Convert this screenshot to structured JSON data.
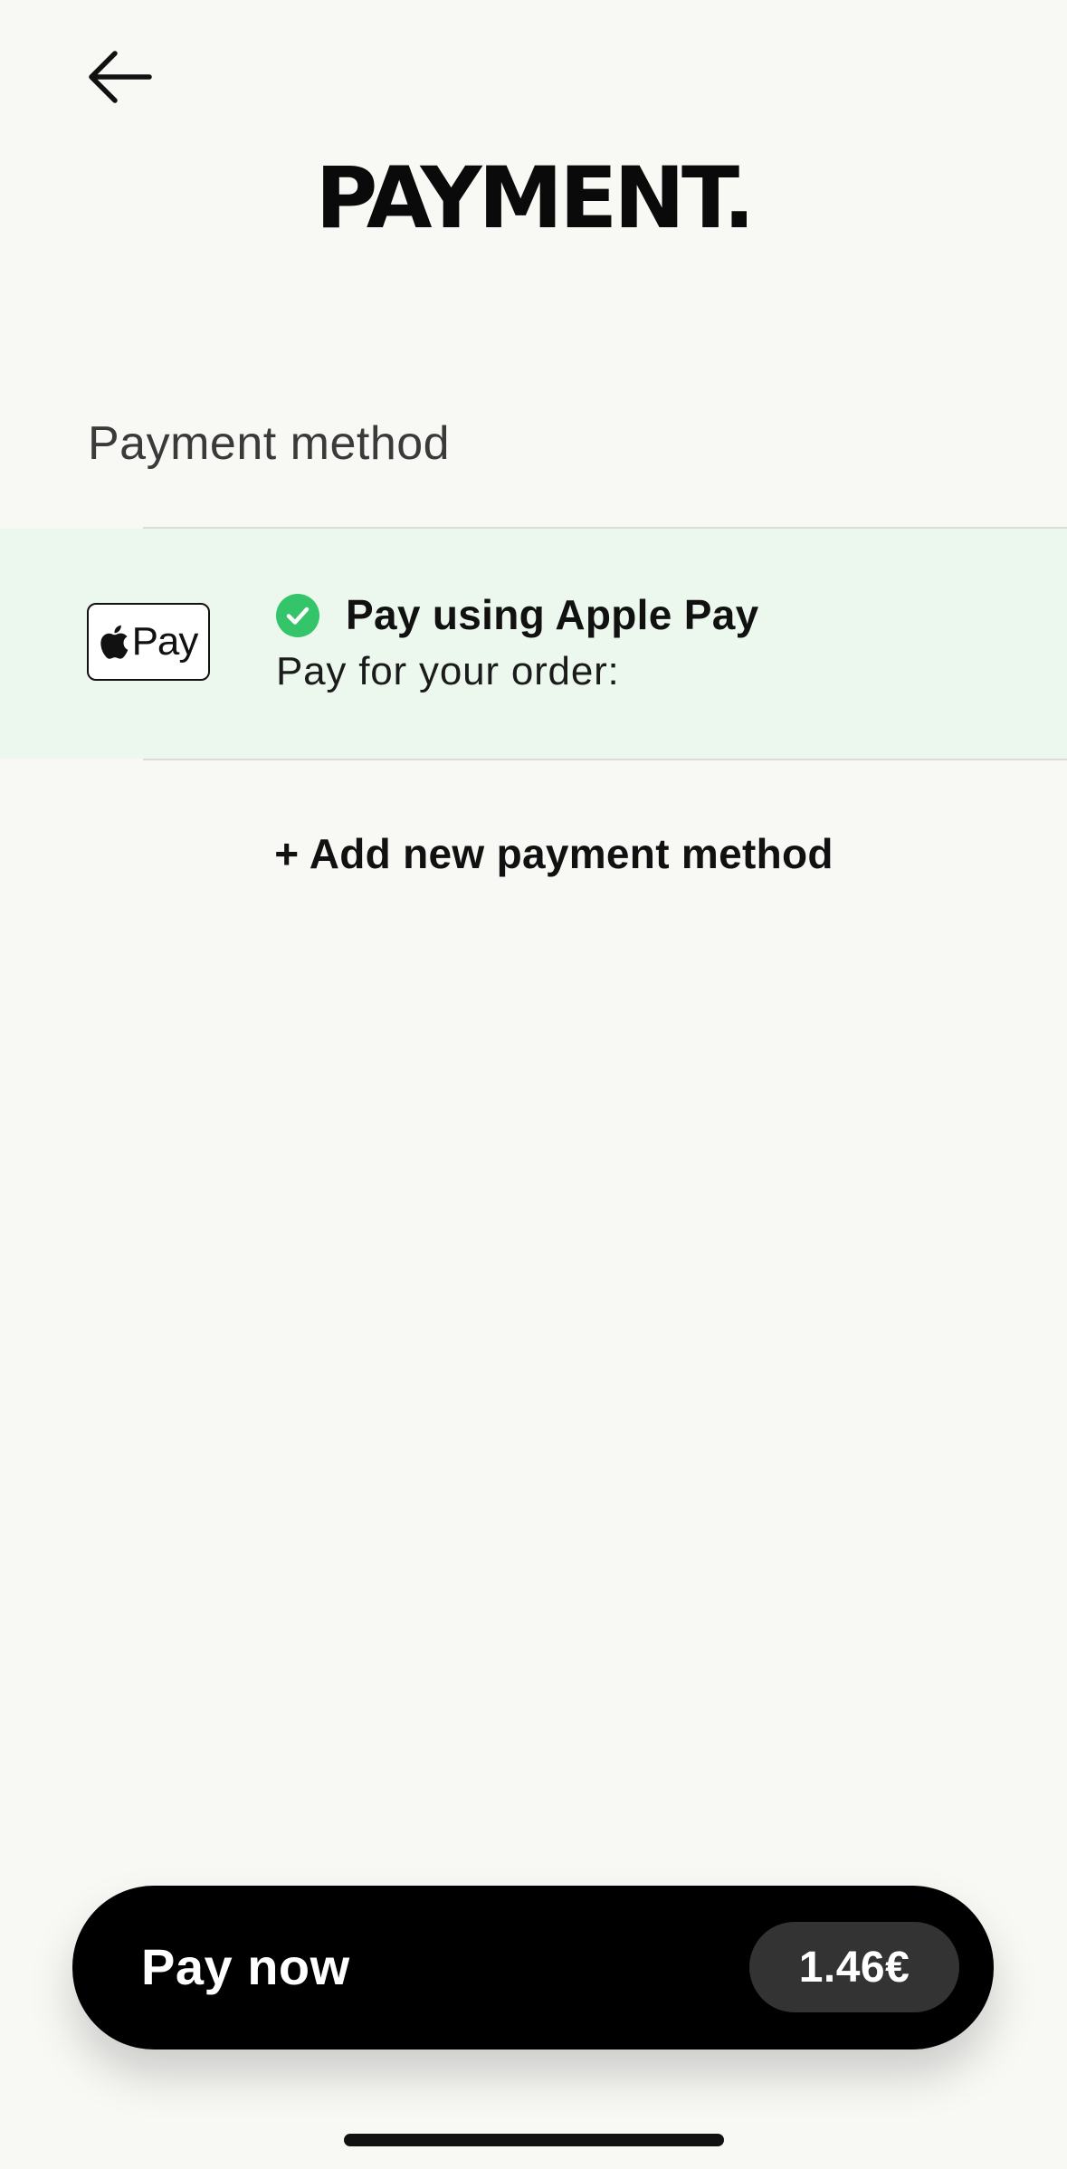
{
  "header": {
    "back_icon": "arrow-left-icon",
    "title": "PAYMENT."
  },
  "payment_section": {
    "label": "Payment method",
    "selected_method": {
      "logo_icon": "apple-pay-logo-icon",
      "logo_text": "Pay",
      "selected_icon": "check-circle-icon",
      "title": "Pay using Apple Pay",
      "subtitle": "Pay for your order:"
    },
    "add_method_label": "+ Add new payment method"
  },
  "footer": {
    "pay_label": "Pay now",
    "amount": "1.46€"
  },
  "colors": {
    "background": "#f8f8f5",
    "selected_row": "#ecf8ee",
    "check_green": "#34c46a",
    "pay_bar": "#000000",
    "amount_pill": "#333333"
  }
}
